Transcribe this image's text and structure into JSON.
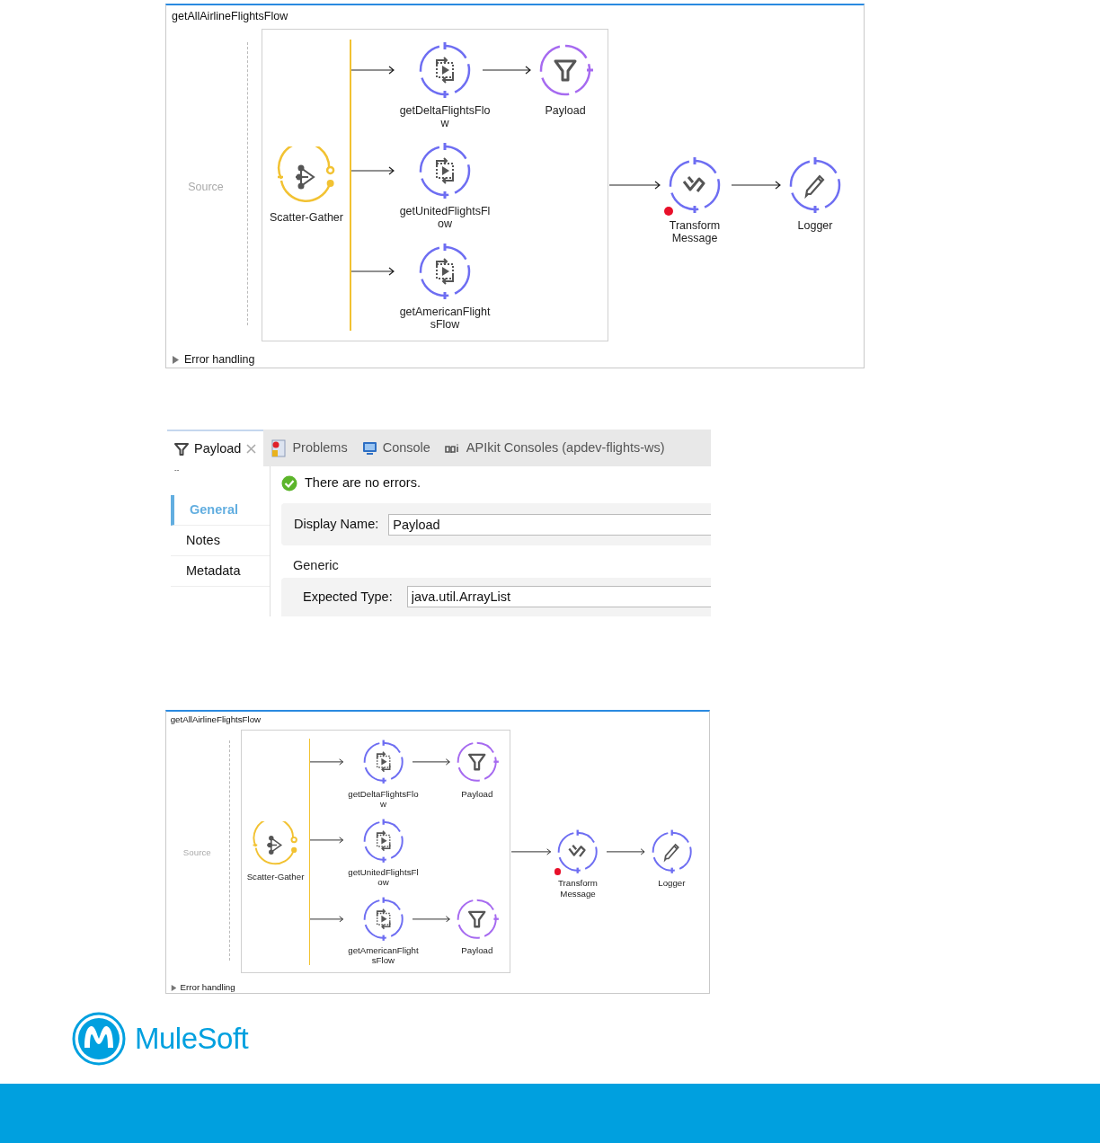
{
  "flows": [
    {
      "title": "getAllAirlineFlightsFlow",
      "source": "Source",
      "router": {
        "label": "Scatter-Gather",
        "kind": "scatter"
      },
      "branches": [
        {
          "label": "getDeltaFlightsFlow",
          "kind": "flow_ref",
          "next": {
            "label": "Payload",
            "kind": "filter"
          }
        },
        {
          "label": "getUnitedFlightsFlow",
          "kind": "flow_ref"
        },
        {
          "label": "getAmericanFlightsFlow",
          "kind": "flow_ref"
        }
      ],
      "steps": [
        {
          "label": "Transform Message",
          "kind": "transform",
          "error": true
        },
        {
          "label": "Logger",
          "kind": "logger",
          "error": false
        }
      ],
      "error_handling": {
        "label": "Error handling",
        "expanded": false
      }
    },
    {
      "title": "getAllAirlineFlightsFlow",
      "source": "Source",
      "router": {
        "label": "Scatter-Gather",
        "kind": "scatter"
      },
      "branches": [
        {
          "label": "getDeltaFlightsFlow",
          "kind": "flow_ref",
          "next": {
            "label": "Payload",
            "kind": "filter"
          }
        },
        {
          "label": "getUnitedFlightsFlow",
          "kind": "flow_ref"
        },
        {
          "label": "getAmericanFlightsFlow",
          "kind": "flow_ref",
          "next": {
            "label": "Payload",
            "kind": "filter"
          }
        }
      ],
      "steps": [
        {
          "label": "Transform Message",
          "kind": "transform",
          "error": true
        },
        {
          "label": "Logger",
          "kind": "logger",
          "error": false
        }
      ],
      "error_handling": {
        "label": "Error handling",
        "expanded": false
      }
    }
  ],
  "properties": {
    "tabs": [
      {
        "label": "Payload",
        "kind": "filter",
        "selected": true,
        "closable": true
      },
      {
        "label": "Problems",
        "kind": "problems",
        "selected": false,
        "closable": false
      },
      {
        "label": "Console",
        "kind": "console",
        "selected": false,
        "closable": false
      },
      {
        "label": "APIkit Consoles (apdev-flights-ws)",
        "kind": "api",
        "selected": false,
        "closable": false
      }
    ],
    "minimized_mark": "--",
    "nav": [
      {
        "label": "General",
        "selected": true
      },
      {
        "label": "Notes",
        "selected": false
      },
      {
        "label": "Metadata",
        "selected": false
      }
    ],
    "status": "There are no errors.",
    "display_name": {
      "label": "Display Name:",
      "value": "Payload"
    },
    "group": "Generic",
    "expected_type": {
      "label": "Expected Type:",
      "value": "java.util.ArrayList"
    }
  },
  "logo": {
    "text": "MuleSoft"
  }
}
